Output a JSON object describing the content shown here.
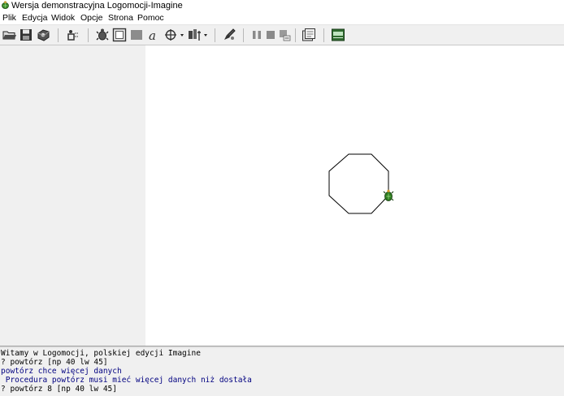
{
  "window": {
    "title": "Wersja demonstracyjna Logomocji-Imagine",
    "icon": "turtle-app-icon"
  },
  "menu": {
    "items": [
      {
        "label": "Plik"
      },
      {
        "label": "Edycja"
      },
      {
        "label": "Widok"
      },
      {
        "label": "Opcje"
      },
      {
        "label": "Strona"
      },
      {
        "label": "Pomoc"
      }
    ]
  },
  "toolbar": {
    "buttons": [
      {
        "icon": "open-folder-icon"
      },
      {
        "icon": "save-disk-icon"
      },
      {
        "icon": "project-settings-icon"
      },
      {
        "icon": "new-turtle-icon"
      },
      {
        "icon": "turtle-tool-icon"
      },
      {
        "icon": "frame-tool-icon"
      },
      {
        "icon": "filled-rectangle-icon"
      },
      {
        "icon": "text-tool-icon"
      },
      {
        "icon": "turtle-shape-dropdown-icon"
      },
      {
        "icon": "pen-properties-dropdown-icon"
      },
      {
        "icon": "paint-tool-icon"
      },
      {
        "icon": "pause-icon"
      },
      {
        "icon": "stop-icon"
      },
      {
        "icon": "run-icon"
      },
      {
        "icon": "page-view-icon"
      },
      {
        "icon": "memory-display-icon"
      }
    ]
  },
  "canvas": {
    "drawing": "octagon",
    "turtle_icon": "turtle-icon",
    "colors": {
      "line": "#000000",
      "turtle": "#2e7d1f"
    }
  },
  "console": {
    "lines": [
      {
        "text": "Witamy w Logomocji, polskiej edycji Imagine",
        "color": "black"
      },
      {
        "text": "? powtórz [np 40 lw 45]",
        "color": "black"
      },
      {
        "text": "powtórz chce więcej danych",
        "color": "blue"
      },
      {
        "text": " Procedura powtórz musi mieć więcej danych niż dostała",
        "color": "blue"
      },
      {
        "text": "? powtórz 8 [np 40 lw 45]",
        "color": "black"
      }
    ]
  }
}
